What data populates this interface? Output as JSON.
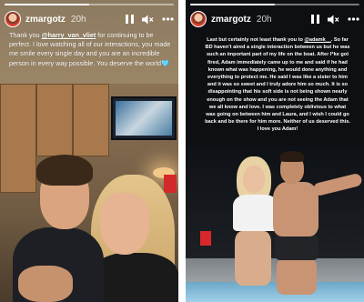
{
  "stories": [
    {
      "username": "zmargotz",
      "time": "20h",
      "progress_fraction": 0.5,
      "caption": {
        "before_mention": "Thank you ",
        "mention": "@harry_van_vliet",
        "after_mention": " for continuing to be perfect. I love watching all of our interactions, you made me smile every single day and you are an incredible person in every way possible. You deserve the world🩵"
      },
      "icons": [
        "avatar",
        "pause-icon",
        "mute-icon",
        "more-icon"
      ]
    },
    {
      "username": "zmargotz",
      "time": "20h",
      "progress_fraction": 0.5,
      "caption": {
        "before_mention": "Last but certainly not least thank you to ",
        "mention": "@adamk__",
        "after_mention": ". So far BD haven't aired a single interaction between us but he was such an important part of my life on the boat. After I*ke got fired, Adam immediately came up to me and said if he had known what was happening, he would done anything and everything to protect me. He said I was like a sister to him and it was so sweet and I truly adore him so much. It is so disappointing that his soft side is not being shown nearly enough on the show and you are not seeing the Adam that we all know and love. I was completely oblivious to what was going on between him and Laura, and I wish I could go back and be there for him more. Neither of us deserved this. I love you Adam!"
      },
      "icons": [
        "avatar",
        "pause-icon",
        "mute-icon",
        "more-icon"
      ]
    }
  ],
  "colors": {
    "text": "#ffffff",
    "left_background": "#7a6a55",
    "right_background": "#0d0f12",
    "cup_red": "#d22a2a"
  }
}
